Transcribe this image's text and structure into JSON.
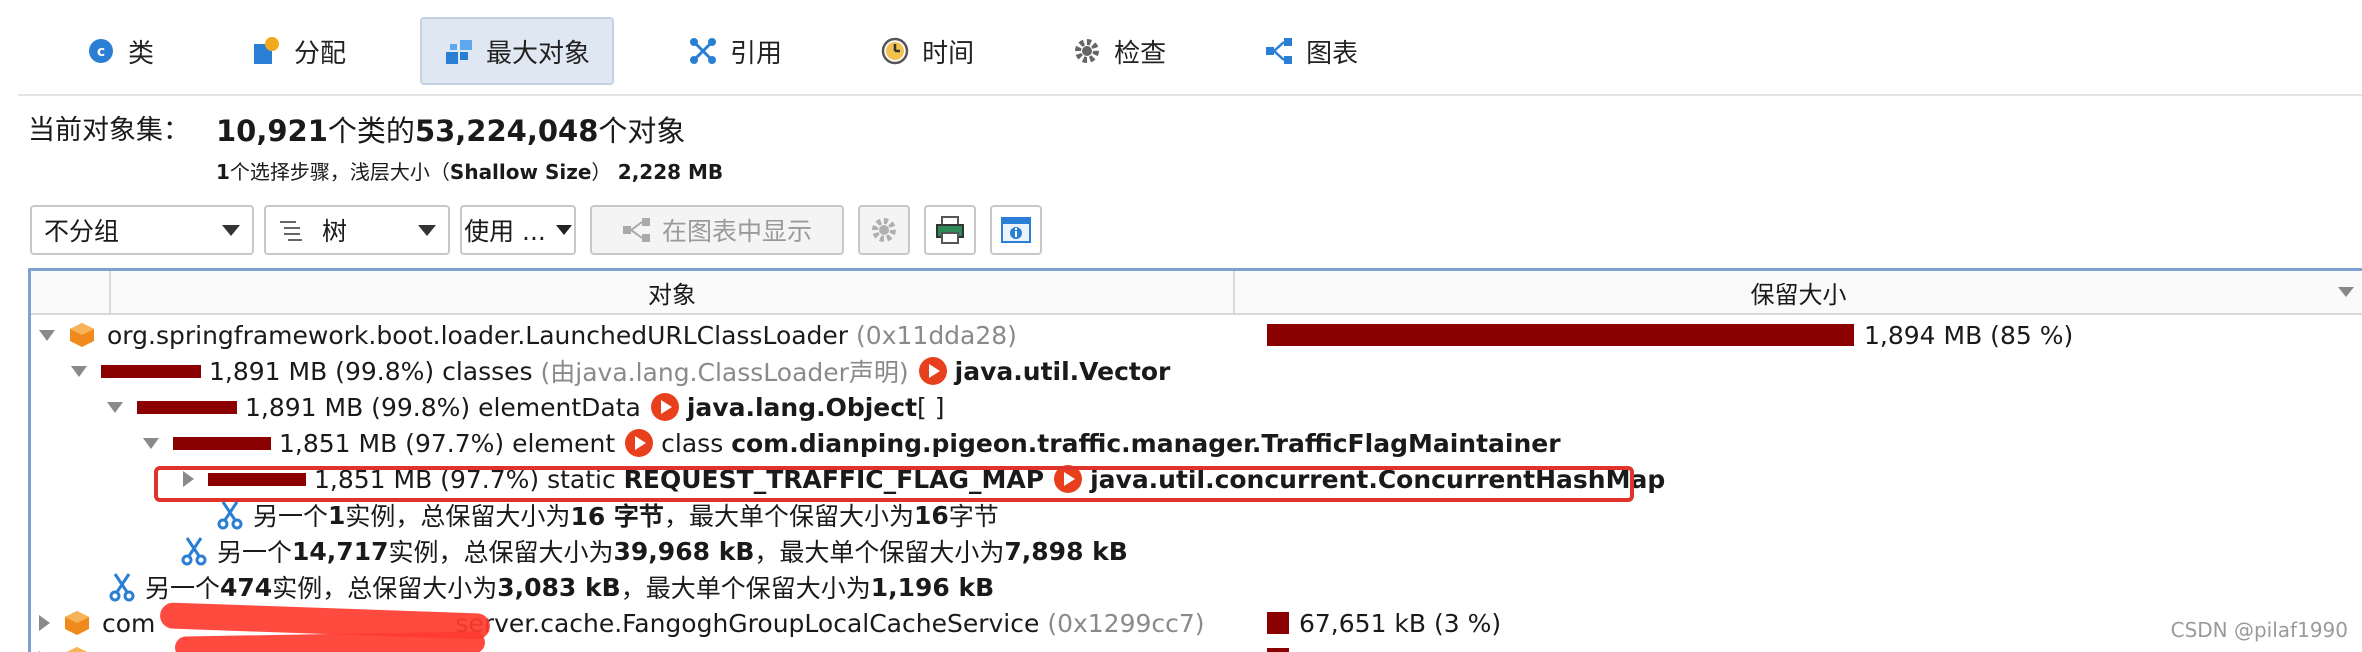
{
  "tabs": [
    {
      "label": "类",
      "icon": "class-icon"
    },
    {
      "label": "分配",
      "icon": "allocation-icon"
    },
    {
      "label": "最大对象",
      "icon": "biggest-objects-icon",
      "active": true
    },
    {
      "label": "引用",
      "icon": "references-icon"
    },
    {
      "label": "时间",
      "icon": "time-icon"
    },
    {
      "label": "检查",
      "icon": "inspection-icon"
    },
    {
      "label": "图表",
      "icon": "graph-icon"
    }
  ],
  "objset": {
    "label": "当前对象集：",
    "classes_count": "10,921",
    "classes_word": "个类的",
    "objects_count": "53,224,048",
    "objects_word": "个对象",
    "sub_steps": "1",
    "sub_text": "个选择步骤，浅层大小（",
    "sub_shallow": "Shallow Size",
    "sub_close": "）",
    "sub_size": "2,228 MB"
  },
  "toolbar": {
    "group_select": "不分组",
    "view_select": "树",
    "use_button": "使用 ...",
    "show_graph_button": "在图表中显示"
  },
  "table": {
    "col_object": "对象",
    "col_retained": "保留大小",
    "rows": [
      {
        "name": "org.springframework.boot.loader.LaunchedURLClassLoader",
        "addr": "(0x11dda28)",
        "retained": "1,894 MB (85 %)",
        "retained_frac": 0.85
      },
      {
        "size": "1,891 MB (99.8%)",
        "field": "classes",
        "decl": "(由java.lang.ClassLoader声明)",
        "target": "java.util.Vector"
      },
      {
        "size": "1,891 MB (99.8%)",
        "field": "elementData",
        "target": "java.lang.Object",
        "target_suffix": "[ ]"
      },
      {
        "size": "1,851 MB (97.7%)",
        "field": "element",
        "kind": "class",
        "target": "com.dianping.pigeon.traffic.manager.TrafficFlagMaintainer"
      },
      {
        "size": "1,851 MB (97.7%)",
        "kind": "static",
        "field": "REQUEST_TRAFFIC_FLAG_MAP",
        "target": "java.util.concurrent.ConcurrentHashMap"
      },
      {
        "p1": "另一个",
        "count": "1",
        "p2": "实例，总保留大小为",
        "total": "16 字节",
        "p3": "，最大单个保留大小为",
        "max": "16",
        "p4": " 字节"
      },
      {
        "p1": "另一个",
        "count": "14,717",
        "p2": "实例，总保留大小为",
        "total": "39,968 kB",
        "p3": "，最大单个保留大小为",
        "max": "7,898 kB",
        "p4": ""
      },
      {
        "p1": "另一个",
        "count": "474",
        "p2": "实例，总保留大小为",
        "total": "3,083 kB",
        "p3": "，最大单个保留大小为",
        "max": "1,196 kB",
        "p4": ""
      },
      {
        "name_prefix": "com",
        "name_suffix": "server.cache.FangoghGroupLocalCacheService",
        "addr": "(0x1299cc7)",
        "retained": "67,651 kB (3 %)",
        "retained_frac": 0.03
      },
      {
        "retained_frac": 0.03
      }
    ]
  },
  "watermark": "CSDN @pilaf1990",
  "colors": {
    "bar": "#8b0000",
    "arrow": "#e8401c",
    "highlight": "#e0332c",
    "active_tab": "#dfe8f2"
  }
}
